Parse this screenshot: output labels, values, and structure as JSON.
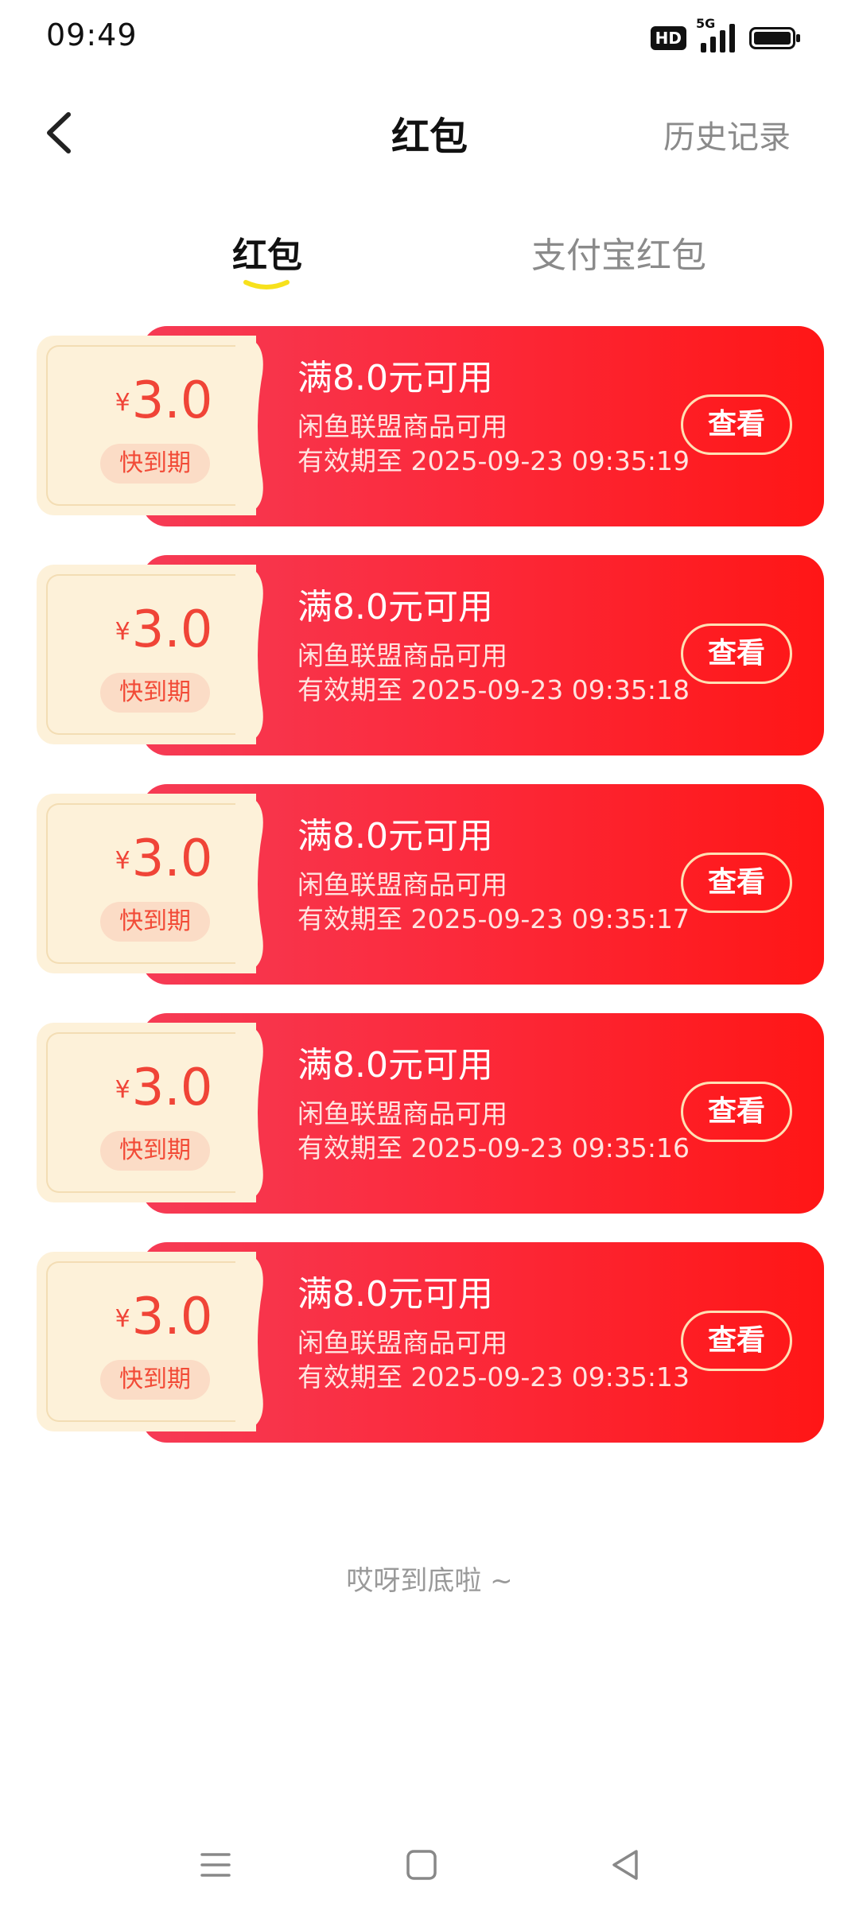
{
  "status_bar": {
    "time": "09:49",
    "network": "5G",
    "hd": "HD"
  },
  "header": {
    "title": "红包",
    "history": "历史记录"
  },
  "tabs": [
    {
      "label": "红包",
      "active": true
    },
    {
      "label": "支付宝红包",
      "active": false
    }
  ],
  "coupons": [
    {
      "currency": "¥",
      "amount": "3.0",
      "badge": "快到期",
      "condition": "满8.0元可用",
      "scope": "闲鱼联盟商品可用",
      "expiry": "有效期至 2025-09-23 09:35:19",
      "button": "查看"
    },
    {
      "currency": "¥",
      "amount": "3.0",
      "badge": "快到期",
      "condition": "满8.0元可用",
      "scope": "闲鱼联盟商品可用",
      "expiry": "有效期至 2025-09-23 09:35:18",
      "button": "查看"
    },
    {
      "currency": "¥",
      "amount": "3.0",
      "badge": "快到期",
      "condition": "满8.0元可用",
      "scope": "闲鱼联盟商品可用",
      "expiry": "有效期至 2025-09-23 09:35:17",
      "button": "查看"
    },
    {
      "currency": "¥",
      "amount": "3.0",
      "badge": "快到期",
      "condition": "满8.0元可用",
      "scope": "闲鱼联盟商品可用",
      "expiry": "有效期至 2025-09-23 09:35:16",
      "button": "查看"
    },
    {
      "currency": "¥",
      "amount": "3.0",
      "badge": "快到期",
      "condition": "满8.0元可用",
      "scope": "闲鱼联盟商品可用",
      "expiry": "有效期至 2025-09-23 09:35:13",
      "button": "查看"
    }
  ],
  "footer_note": "哎呀到底啦 ~",
  "colors": {
    "coupon_red_start": "#f63b55",
    "coupon_red_end": "#ff1616",
    "stub_bg": "#fdf1d9",
    "amount_red": "#f04437",
    "tab_underline": "#f7e11c"
  },
  "nav_icons": [
    "menu-icon",
    "home-square-icon",
    "back-triangle-icon"
  ]
}
